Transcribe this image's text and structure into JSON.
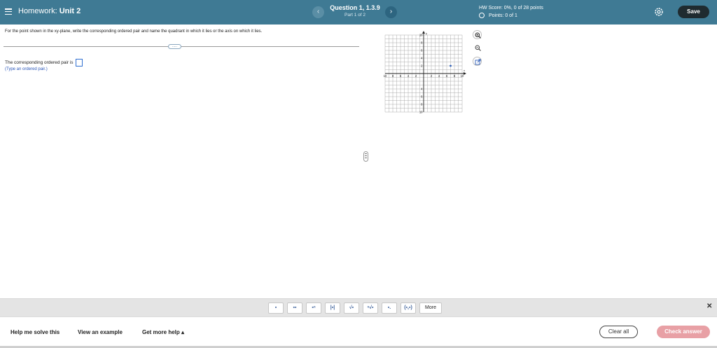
{
  "header": {
    "title_prefix": "Homework: ",
    "title_main": "Unit 2",
    "prev_icon": "chevron-left-icon",
    "next_icon": "chevron-right-icon",
    "question_title": "Question 1, 1.3.9",
    "question_part": "Part 1 of 2",
    "hw_score": "HW Score: 0%, 0 of 28 points",
    "points": "Points: 0 of 1",
    "settings_icon": "gear-icon",
    "save_label": "Save"
  },
  "question": {
    "prompt": "For the point shown in the xy-plane, write the corresponding ordered pair and name the quadrant in which it lies or the axis on which it lies.",
    "answer_label": "The corresponding ordered pair is",
    "answer_value": "",
    "answer_hint": "(Type an ordered pair.)",
    "expand_label": "....."
  },
  "graph": {
    "y_axis_label": "y",
    "x_axis_label": "x",
    "x_ticks": [
      "10",
      "8",
      "6",
      "4",
      "2",
      "2",
      "4",
      "6",
      "8",
      "10"
    ],
    "y_ticks": [
      "10",
      "8",
      "6",
      "4",
      "2",
      "4",
      "6",
      "8",
      "10"
    ],
    "xlim": [
      -10,
      10
    ],
    "ylim": [
      -10,
      10
    ],
    "point": {
      "x": 7,
      "y": 2
    },
    "point_color": "#2f5fb8",
    "zoom_in_icon": "zoom-in-icon",
    "zoom_out_icon": "zoom-out-icon",
    "popout_icon": "external-link-icon"
  },
  "math_toolbar": {
    "buttons": [
      "fraction-icon",
      "mixed-number-icon",
      "exponent-icon",
      "absolute-value-icon",
      "square-root-icon",
      "nth-root-icon",
      "subscript-icon",
      "ordered-pair-icon"
    ],
    "button_glyphs": [
      "▪",
      "▪▪",
      "▪ⁿ",
      "|▪|",
      "√▪",
      "ⁿ√▪",
      "▪.",
      "(▪,▪)"
    ],
    "more_label": "More",
    "close_label": "✕"
  },
  "footer": {
    "help_solve": "Help me solve this",
    "view_example": "View an example",
    "get_more_help": "Get more help ▴",
    "clear_all": "Clear all",
    "check_answer": "Check answer"
  }
}
